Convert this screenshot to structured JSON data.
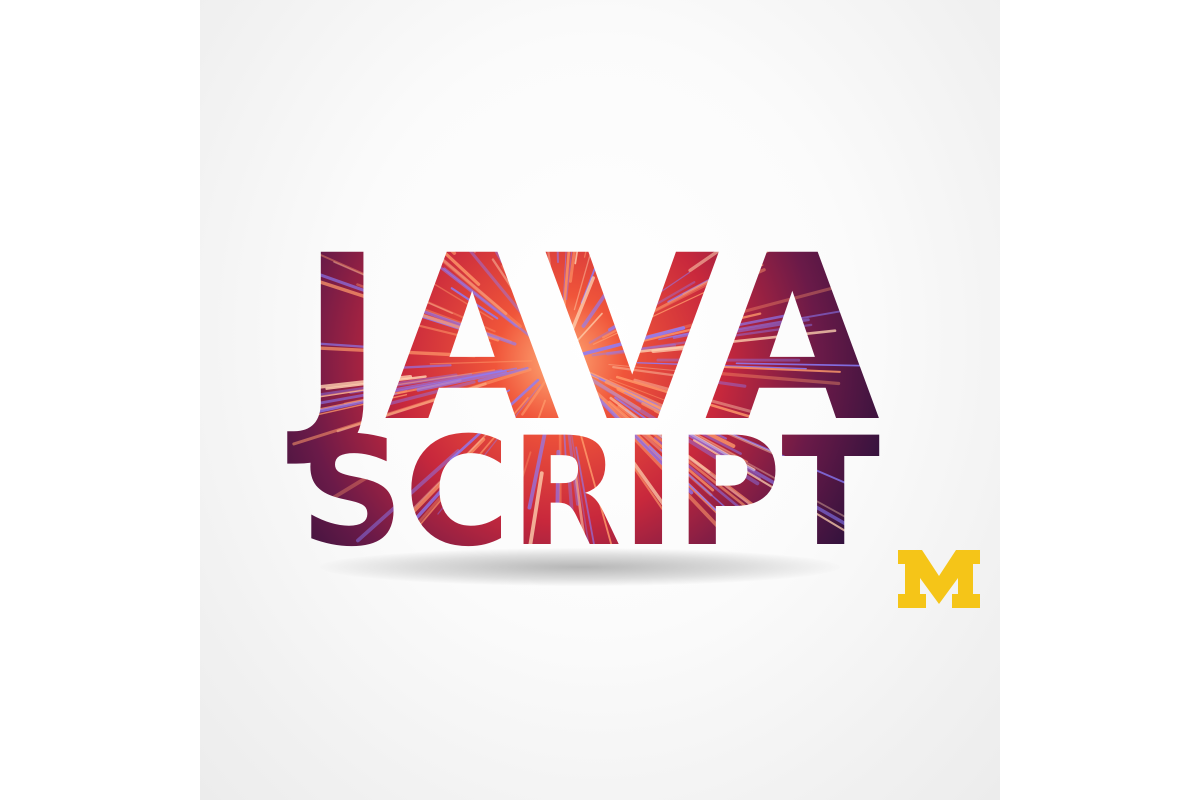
{
  "logo": {
    "line1": "JAVA",
    "line2": "SCRIPT",
    "mark": "M"
  },
  "colors": {
    "background": "#ffffff",
    "fill_dark": "#2a1238",
    "fill_mid": "#8a1c3c",
    "fill_hot": "#f0553a",
    "streak": "#8a7dff",
    "maize": "#f5c518"
  },
  "icons": {
    "mark": "block-m-logo-icon"
  }
}
